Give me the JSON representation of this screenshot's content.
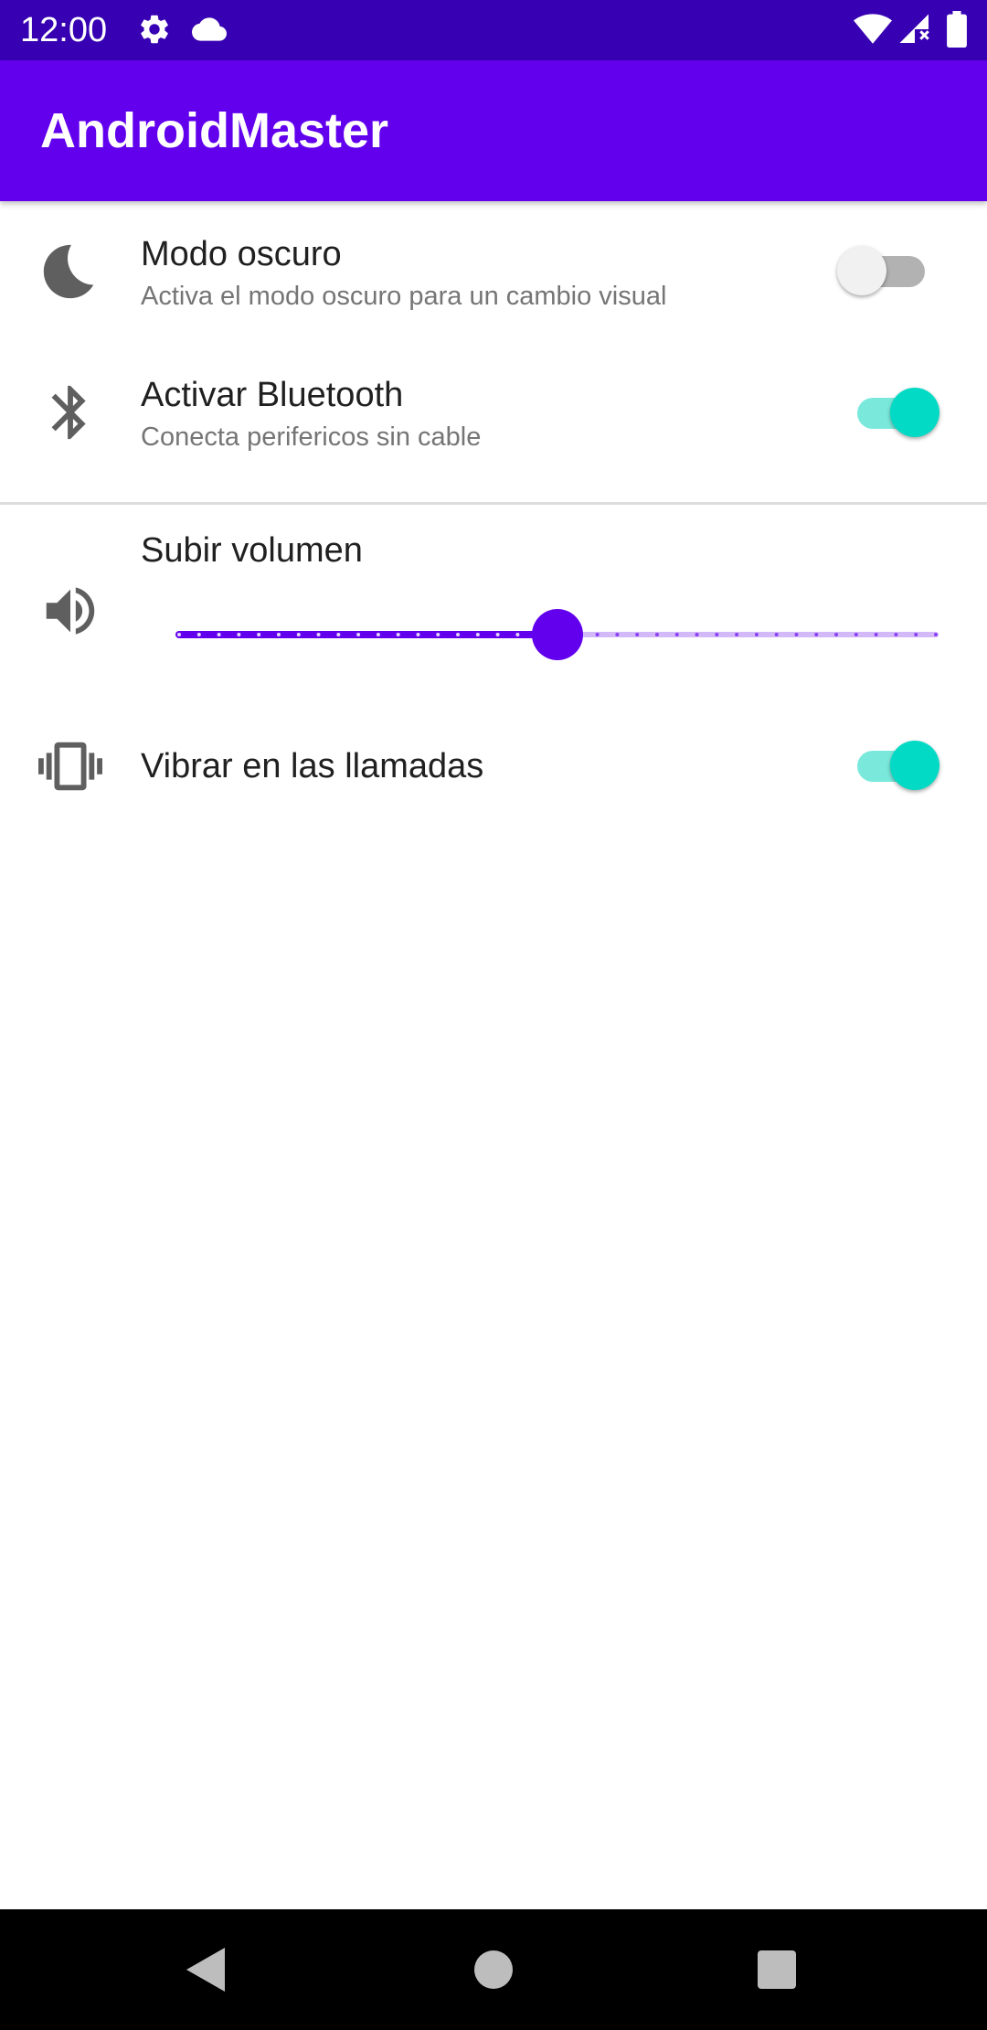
{
  "status_bar": {
    "time": "12:00",
    "left_icons": [
      "gear-icon",
      "cloud-icon"
    ],
    "right_icons": [
      "wifi-icon",
      "signal-icon",
      "battery-icon"
    ],
    "background": "#3700b3"
  },
  "app_bar": {
    "title": "AndroidMaster",
    "background": "#6200ee"
  },
  "settings": {
    "dark_mode": {
      "icon": "moon-icon",
      "title": "Modo oscuro",
      "subtitle": "Activa el modo oscuro para un cambio visual",
      "enabled": false
    },
    "bluetooth": {
      "icon": "bluetooth-icon",
      "title": "Activar Bluetooth",
      "subtitle": "Conecta perifericos sin cable",
      "enabled": true
    },
    "volume": {
      "icon": "volume-icon",
      "title": "Subir volumen",
      "value": 0.5,
      "steps": 38
    },
    "vibrate": {
      "icon": "vibrate-icon",
      "title": "Vibrar en las llamadas",
      "enabled": true
    }
  },
  "nav_bar": {
    "buttons": [
      "back-icon",
      "home-icon",
      "recents-icon"
    ]
  },
  "colors": {
    "primary": "#6200ee",
    "primary_dark": "#3700b3",
    "accent": "#03dac5",
    "accent_track": "#7ae9dc",
    "icon_gray": "#5f5f5f"
  }
}
